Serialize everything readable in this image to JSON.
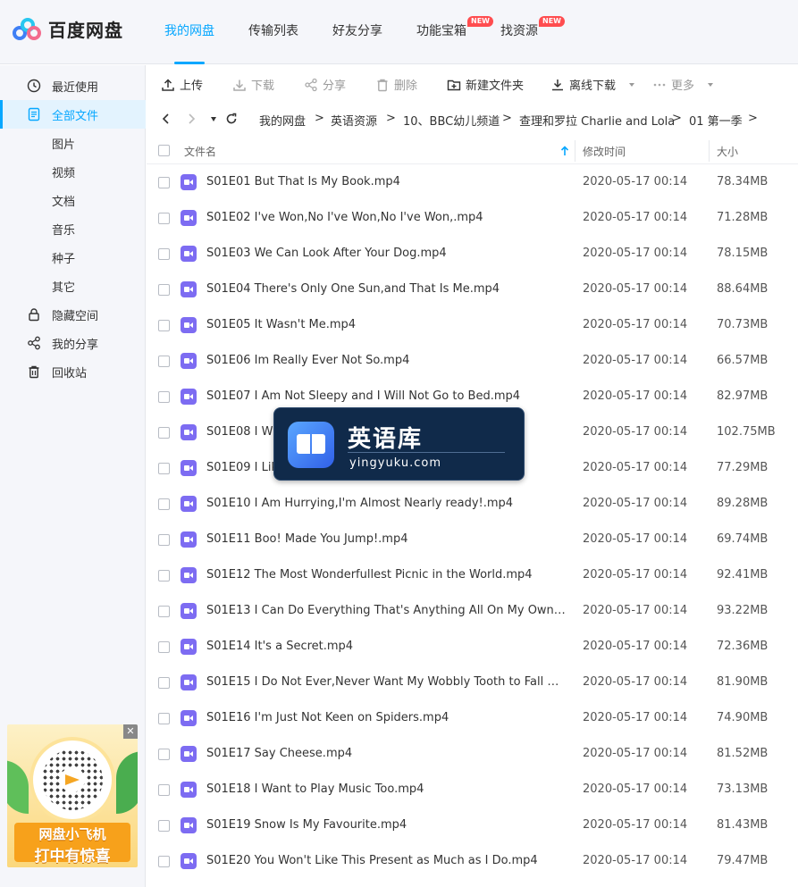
{
  "app": {
    "name": "百度网盘"
  },
  "nav": [
    {
      "label": "我的网盘",
      "active": true,
      "badge": ""
    },
    {
      "label": "传输列表",
      "active": false,
      "badge": ""
    },
    {
      "label": "好友分享",
      "active": false,
      "badge": ""
    },
    {
      "label": "功能宝箱",
      "active": false,
      "badge": "NEW"
    },
    {
      "label": "找资源",
      "active": false,
      "badge": "NEW"
    }
  ],
  "sidebar": {
    "items": [
      {
        "label": "最近使用",
        "icon": "clock-icon"
      },
      {
        "label": "全部文件",
        "icon": "file-icon",
        "active": true
      },
      {
        "label": "图片",
        "icon": ""
      },
      {
        "label": "视频",
        "icon": ""
      },
      {
        "label": "文档",
        "icon": ""
      },
      {
        "label": "音乐",
        "icon": ""
      },
      {
        "label": "种子",
        "icon": ""
      },
      {
        "label": "其它",
        "icon": ""
      },
      {
        "label": "隐藏空间",
        "icon": "lock-icon"
      },
      {
        "label": "我的分享",
        "icon": "share-icon"
      },
      {
        "label": "回收站",
        "icon": "trash-icon"
      }
    ]
  },
  "ad": {
    "line1": "网盘小飞机",
    "line2": "打中有惊喜",
    "close": "✕"
  },
  "toolbar": {
    "upload": "上传",
    "download": "下载",
    "share": "分享",
    "delete": "删除",
    "new_folder": "新建文件夹",
    "offline_download": "离线下载",
    "more": "更多"
  },
  "breadcrumb": [
    "我的网盘",
    "英语资源",
    "10、BBC幼儿频道",
    "查理和罗拉 Charlie and Lola",
    "01 第一季"
  ],
  "table": {
    "headers": {
      "name": "文件名",
      "modified": "修改时间",
      "size": "大小"
    },
    "rows": [
      {
        "name": "S01E01 But That Is My Book.mp4",
        "date": "2020-05-17 00:14",
        "size": "78.34MB"
      },
      {
        "name": "S01E02 I've Won,No I've Won,No I've Won,.mp4",
        "date": "2020-05-17 00:14",
        "size": "71.28MB"
      },
      {
        "name": "S01E03 We Can Look After Your Dog.mp4",
        "date": "2020-05-17 00:14",
        "size": "78.15MB"
      },
      {
        "name": "S01E04 There's Only One Sun,and That Is Me.mp4",
        "date": "2020-05-17 00:14",
        "size": "88.64MB"
      },
      {
        "name": "S01E05 It Wasn't Me.mp4",
        "date": "2020-05-17 00:14",
        "size": "70.73MB"
      },
      {
        "name": "S01E06 Im Really Ever Not So.mp4",
        "date": "2020-05-17 00:14",
        "size": "66.57MB"
      },
      {
        "name": "S01E07 I Am Not Sleepy and I Will Not Go to Bed.mp4",
        "date": "2020-05-17 00:14",
        "size": "82.97MB"
      },
      {
        "name": "S01E08 I Wil",
        "date": "2020-05-17 00:14",
        "size": "102.75MB"
      },
      {
        "name": "S01E09 I Like",
        "date": "2020-05-17 00:14",
        "size": "77.29MB"
      },
      {
        "name": "S01E10 I Am Hurrying,I'm Almost Nearly ready!.mp4",
        "date": "2020-05-17 00:14",
        "size": "89.28MB"
      },
      {
        "name": "S01E11 Boo! Made You Jump!.mp4",
        "date": "2020-05-17 00:14",
        "size": "69.74MB"
      },
      {
        "name": "S01E12 The Most Wonderfullest Picnic in the World.mp4",
        "date": "2020-05-17 00:14",
        "size": "92.41MB"
      },
      {
        "name": "S01E13 I Can Do Everything That's Anything All On My Own.mp4",
        "date": "2020-05-17 00:14",
        "size": "93.22MB"
      },
      {
        "name": "S01E14 It's a Secret.mp4",
        "date": "2020-05-17 00:14",
        "size": "72.36MB"
      },
      {
        "name": "S01E15 I Do Not Ever,Never Want My Wobbly Tooth to Fall Out.m...",
        "date": "2020-05-17 00:14",
        "size": "81.90MB"
      },
      {
        "name": "S01E16 I'm Just Not Keen on Spiders.mp4",
        "date": "2020-05-17 00:14",
        "size": "74.90MB"
      },
      {
        "name": "S01E17 Say Cheese.mp4",
        "date": "2020-05-17 00:14",
        "size": "81.52MB"
      },
      {
        "name": "S01E18 I Want to Play Music Too.mp4",
        "date": "2020-05-17 00:14",
        "size": "73.13MB"
      },
      {
        "name": "S01E19 Snow Is My Favourite.mp4",
        "date": "2020-05-17 00:14",
        "size": "81.43MB"
      },
      {
        "name": "S01E20 You Won't Like This Present as Much as I Do.mp4",
        "date": "2020-05-17 00:14",
        "size": "79.47MB"
      }
    ]
  },
  "watermark": {
    "title": "英语库",
    "subtitle": "yingyuku.com"
  },
  "colors": {
    "accent": "#06a7ff",
    "video_icon": "#7d6cf2",
    "badge": "#ff4d4f"
  }
}
